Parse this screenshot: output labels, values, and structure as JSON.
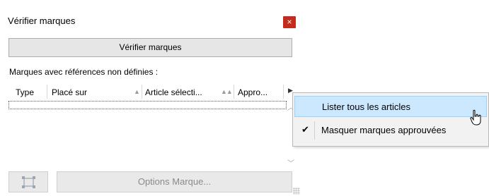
{
  "window": {
    "title": "Vérifier marques",
    "close_glyph": "×"
  },
  "verify_button": {
    "label": "Vérifier marques"
  },
  "section_label": "Marques avec références non définies :",
  "table": {
    "columns": [
      {
        "label": "Type"
      },
      {
        "label": "Placé sur",
        "sort_glyph": "▲"
      },
      {
        "label": "Article sélecti...",
        "sort_glyph": "▲▲"
      },
      {
        "label": "Appro..."
      }
    ],
    "rows": []
  },
  "bottom": {
    "icon_button": {
      "icon": "frame-icon"
    },
    "options_button": {
      "label": "Options Marque..."
    }
  },
  "context_menu": {
    "items": [
      {
        "label": "Lister tous les articles",
        "checked": false,
        "hovered": true
      },
      {
        "label": "Masquer marques approuvées",
        "checked": true,
        "checkmark": "✔"
      }
    ]
  },
  "colors": {
    "close_button": "#c42b1c",
    "menu_hover": "#cce8ff",
    "disabled_text": "#8a8a8a"
  }
}
